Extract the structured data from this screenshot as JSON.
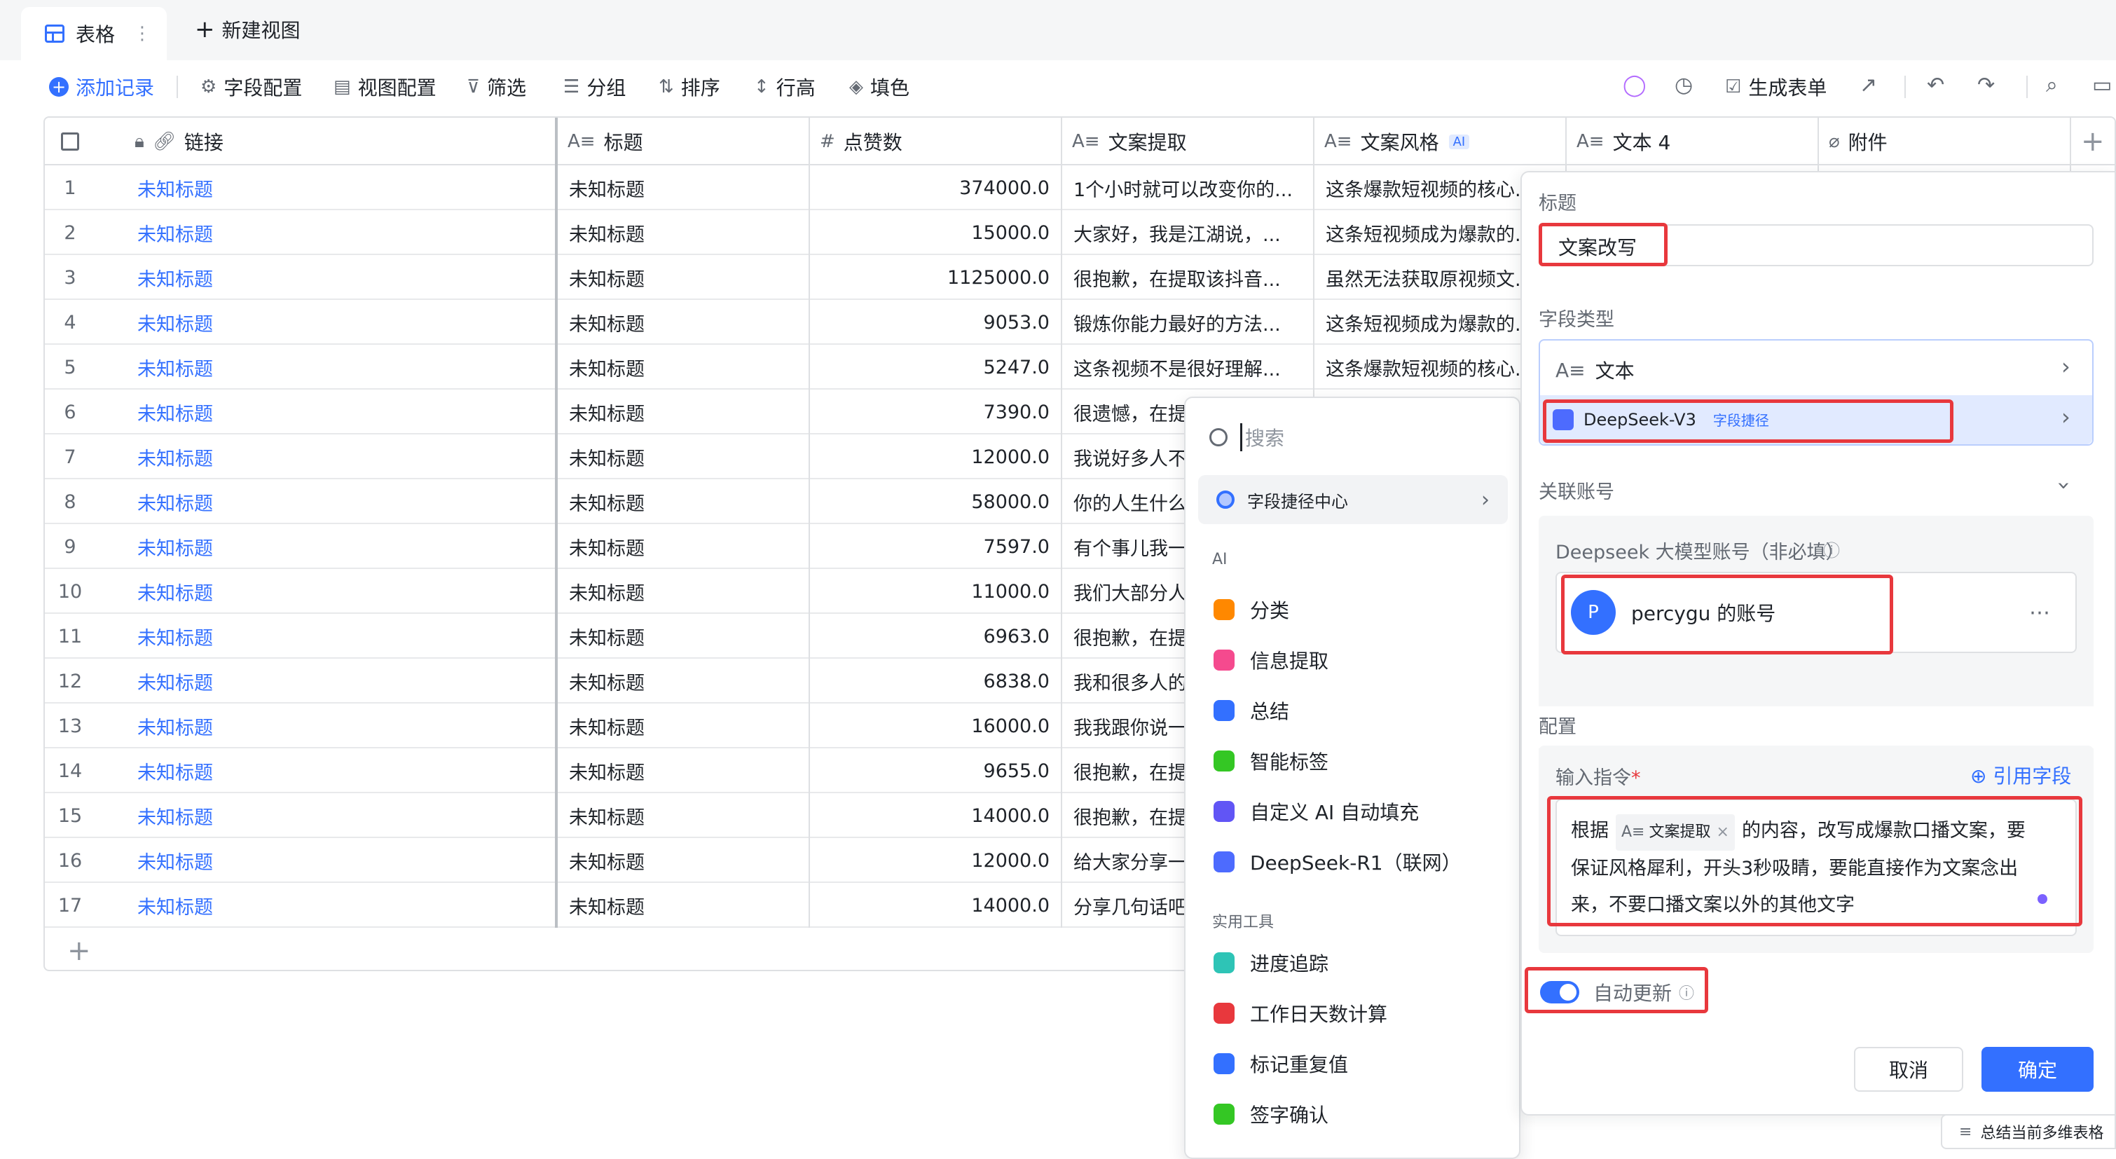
{
  "tabs": {
    "active": "表格",
    "new_view": "新建视图"
  },
  "toolbar": {
    "add_record": "添加记录",
    "field_config": "字段配置",
    "view_config": "视图配置",
    "filter": "筛选",
    "group": "分组",
    "sort": "排序",
    "row_height": "行高",
    "fill": "填色",
    "generate_form": "生成表单"
  },
  "columns": [
    {
      "label": "链接",
      "icon": "link-icon"
    },
    {
      "label": "标题",
      "icon": "text-field-icon"
    },
    {
      "label": "点赞数",
      "icon": "number-field-icon"
    },
    {
      "label": "文案提取",
      "icon": "text-field-icon"
    },
    {
      "label": "文案风格",
      "icon": "text-field-icon",
      "badge": "AI"
    },
    {
      "label": "文本 4",
      "icon": "text-field-icon"
    },
    {
      "label": "附件",
      "icon": "attachment-icon"
    }
  ],
  "rows": [
    {
      "n": "1",
      "link": "未知标题",
      "title": "未知标题",
      "likes": "374000.0",
      "extract": "1个小时就可以改变你的...",
      "style": "这条爆款短视频的核心..."
    },
    {
      "n": "2",
      "link": "未知标题",
      "title": "未知标题",
      "likes": "15000.0",
      "extract": "大家好，我是江湖说，...",
      "style": "这条短视频成为爆款的..."
    },
    {
      "n": "3",
      "link": "未知标题",
      "title": "未知标题",
      "likes": "1125000.0",
      "extract": "很抱歉，在提取该抖音...",
      "style": "虽然无法获取原视频文..."
    },
    {
      "n": "4",
      "link": "未知标题",
      "title": "未知标题",
      "likes": "9053.0",
      "extract": "锻炼你能力最好的方法...",
      "style": "这条短视频成为爆款的..."
    },
    {
      "n": "5",
      "link": "未知标题",
      "title": "未知标题",
      "likes": "5247.0",
      "extract": "这条视频不是很好理解...",
      "style": "这条爆款短视频的核心..."
    },
    {
      "n": "6",
      "link": "未知标题",
      "title": "未知标题",
      "likes": "7390.0",
      "extract": "很遗憾，在提取该",
      "style": ""
    },
    {
      "n": "7",
      "link": "未知标题",
      "title": "未知标题",
      "likes": "12000.0",
      "extract": "我说好多人不会用",
      "style": ""
    },
    {
      "n": "8",
      "link": "未知标题",
      "title": "未知标题",
      "likes": "58000.0",
      "extract": "你的人生什么时候",
      "style": ""
    },
    {
      "n": "9",
      "link": "未知标题",
      "title": "未知标题",
      "likes": "7597.0",
      "extract": "有个事儿我一直想",
      "style": ""
    },
    {
      "n": "10",
      "link": "未知标题",
      "title": "未知标题",
      "likes": "11000.0",
      "extract": "我们大部分人所从",
      "style": ""
    },
    {
      "n": "11",
      "link": "未知标题",
      "title": "未知标题",
      "likes": "6963.0",
      "extract": "很抱歉，在提取文",
      "style": ""
    },
    {
      "n": "12",
      "link": "未知标题",
      "title": "未知标题",
      "likes": "6838.0",
      "extract": "我和很多人的区别",
      "style": ""
    },
    {
      "n": "13",
      "link": "未知标题",
      "title": "未知标题",
      "likes": "16000.0",
      "extract": "我我跟你说一个特",
      "style": ""
    },
    {
      "n": "14",
      "link": "未知标题",
      "title": "未知标题",
      "likes": "9655.0",
      "extract": "很抱歉，在提取该",
      "style": ""
    },
    {
      "n": "15",
      "link": "未知标题",
      "title": "未知标题",
      "likes": "14000.0",
      "extract": "很抱歉，在提取该",
      "style": ""
    },
    {
      "n": "16",
      "link": "未知标题",
      "title": "未知标题",
      "likes": "12000.0",
      "extract": "给大家分享一个拍",
      "style": ""
    },
    {
      "n": "17",
      "link": "未知标题",
      "title": "未知标题",
      "likes": "14000.0",
      "extract": "分享几句话吧啊看",
      "style": ""
    }
  ],
  "dropdown": {
    "search_placeholder": "搜索",
    "center": "字段捷径中心",
    "group_ai": "AI",
    "ai_items": [
      {
        "label": "分类",
        "color": "#ff8800"
      },
      {
        "label": "信息提取",
        "color": "#f54a8e"
      },
      {
        "label": "总结",
        "color": "#3370ff"
      },
      {
        "label": "智能标签",
        "color": "#34c724"
      },
      {
        "label": "自定义 AI 自动填充",
        "color": "#6155f5"
      },
      {
        "label": "DeepSeek-R1（联网）",
        "color": "#4d6bfe"
      }
    ],
    "group_tools": "实用工具",
    "tool_items": [
      {
        "label": "进度追踪",
        "color": "#2ec4b6"
      },
      {
        "label": "工作日天数计算",
        "color": "#e8383d"
      },
      {
        "label": "标记重复值",
        "color": "#3370ff"
      },
      {
        "label": "签字确认",
        "color": "#34c724"
      }
    ]
  },
  "panel": {
    "title_label": "标题",
    "title_value": "文案改写",
    "field_type_label": "字段类型",
    "type_text": "文本",
    "type_deepseek": "DeepSeek-V3",
    "type_tag": "字段捷径",
    "account_label": "关联账号",
    "account_sublabel": "Deepseek 大模型账号（非必填）",
    "account_initial": "P",
    "account_name": "percygu 的账号",
    "config_label": "配置",
    "prompt_label": "输入指令",
    "required_mark": "*",
    "ref_field": "引用字段",
    "prompt_pre": "根据",
    "prompt_chip": "文案提取",
    "prompt_post": "的内容，改写成爆款口播文案，要",
    "prompt_line2": "保证风格犀利，开头3秒吸睛，要能直接作为文案念出",
    "prompt_line3": "来，不要口播文案以外的其他文字",
    "auto_update": "自动更新",
    "cancel": "取消",
    "confirm": "确定"
  },
  "bottom_tip": "总结当前多维表格"
}
